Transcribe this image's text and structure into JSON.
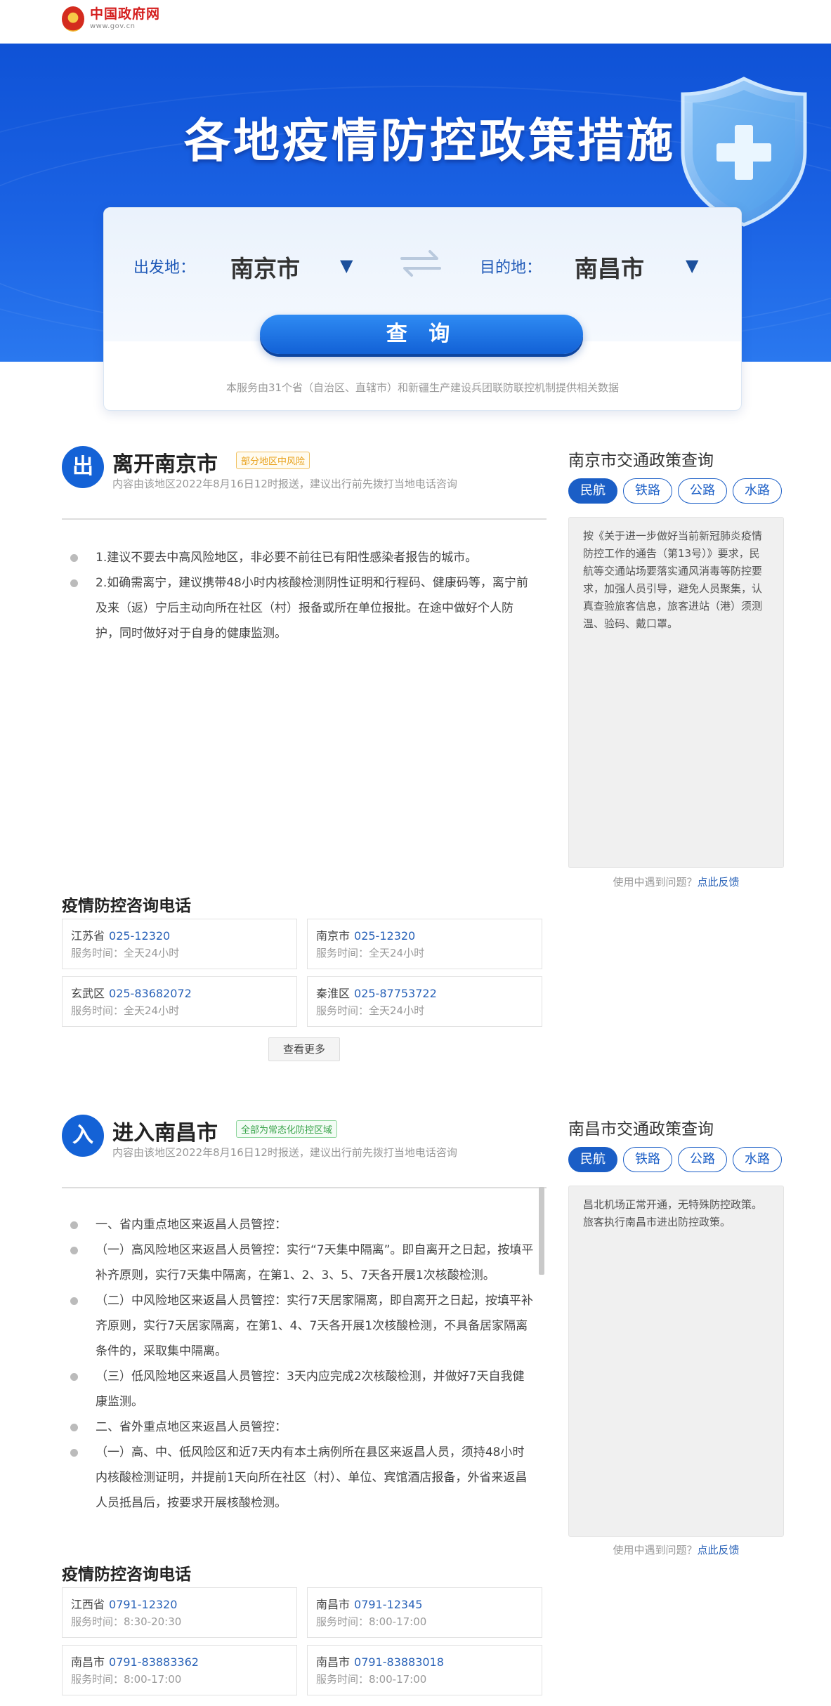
{
  "header": {
    "logo_title": "中国政府网",
    "logo_sub": "www.gov.cn"
  },
  "hero": {
    "title": "各地疫情防控政策措施"
  },
  "search": {
    "from_label": "出发地：",
    "from_city": "南京市",
    "to_label": "目的地：",
    "to_city": "南昌市",
    "query_button": "查 询",
    "note": "本服务由31个省（自治区、直辖市）和新疆生产建设兵团联防联控机制提供相关数据"
  },
  "leave": {
    "badge": "出",
    "title": "离开南京市",
    "risk_tag": "部分地区中风险",
    "subtitle": "内容由该地区2022年8月16日12时报送，建议出行前先拨打当地电话咨询",
    "items": [
      "1.建议不要去中高风险地区，非必要不前往已有阳性感染者报告的城市。",
      "2.如确需离宁，建议携带48小时内核酸检测阴性证明和行程码、健康码等，离宁前及来（返）宁后主动向所在社区（村）报备或所在单位报批。在途中做好个人防护，同时做好对于自身的健康监测。"
    ],
    "phone_title": "疫情防控咨询电话",
    "phones": [
      {
        "region": "江苏省",
        "number": "025-12320",
        "hours": "服务时间：全天24小时"
      },
      {
        "region": "南京市",
        "number": "025-12320",
        "hours": "服务时间：全天24小时"
      },
      {
        "region": "玄武区",
        "number": "025-83682072",
        "hours": "服务时间：全天24小时"
      },
      {
        "region": "秦淮区",
        "number": "025-87753722",
        "hours": "服务时间：全天24小时"
      }
    ],
    "more_button": "查看更多",
    "side_title": "南京市交通政策查询",
    "tabs": [
      "民航",
      "铁路",
      "公路",
      "水路"
    ],
    "policy_text": "按《关于进一步做好当前新冠肺炎疫情防控工作的通告（第13号）》要求，民航等交通站场要落实通风消毒等防控要求，加强人员引导，避免人员聚集，认真查验旅客信息，旅客进站（港）须测温、验码、戴口罩。",
    "feedback_q": "使用中遇到问题？",
    "feedback_link": "点此反馈"
  },
  "enter": {
    "badge": "入",
    "title": "进入南昌市",
    "risk_tag": "全部为常态化防控区域",
    "subtitle": "内容由该地区2022年8月16日12时报送，建议出行前先拨打当地电话咨询",
    "items": [
      "一、省内重点地区来返昌人员管控：",
      "（一）高风险地区来返昌人员管控：实行“7天集中隔离”。即自离开之日起，按填平补齐原则，实行7天集中隔离，在第1、2、3、5、7天各开展1次核酸检测。",
      "（二）中风险地区来返昌人员管控：实行7天居家隔离，即自离开之日起，按填平补齐原则，实行7天居家隔离，在第1、4、7天各开展1次核酸检测，不具备居家隔离条件的，采取集中隔离。",
      "（三）低风险地区来返昌人员管控：3天内应完成2次核酸检测，并做好7天自我健康监测。",
      "二、省外重点地区来返昌人员管控：",
      "（一）高、中、低风险区和近7天内有本土病例所在县区来返昌人员，须持48小时内核酸检测证明，并提前1天向所在社区（村）、单位、宾馆酒店报备，外省来返昌人员抵昌后，按要求开展核酸检测。"
    ],
    "phone_title": "疫情防控咨询电话",
    "phones": [
      {
        "region": "江西省",
        "number": "0791-12320",
        "hours": "服务时间：8:30-20:30"
      },
      {
        "region": "南昌市",
        "number": "0791-12345",
        "hours": "服务时间：8:00-17:00"
      },
      {
        "region": "南昌市",
        "number": "0791-83883362",
        "hours": "服务时间：8:00-17:00"
      },
      {
        "region": "南昌市",
        "number": "0791-83883018",
        "hours": "服务时间：8:00-17:00"
      }
    ],
    "side_title": "南昌市交通政策查询",
    "tabs": [
      "民航",
      "铁路",
      "公路",
      "水路"
    ],
    "policy_text": "昌北机场正常开通，无特殊防控政策。旅客执行南昌市进出防控政策。",
    "feedback_q": "使用中遇到问题？",
    "feedback_link": "点此反馈"
  }
}
